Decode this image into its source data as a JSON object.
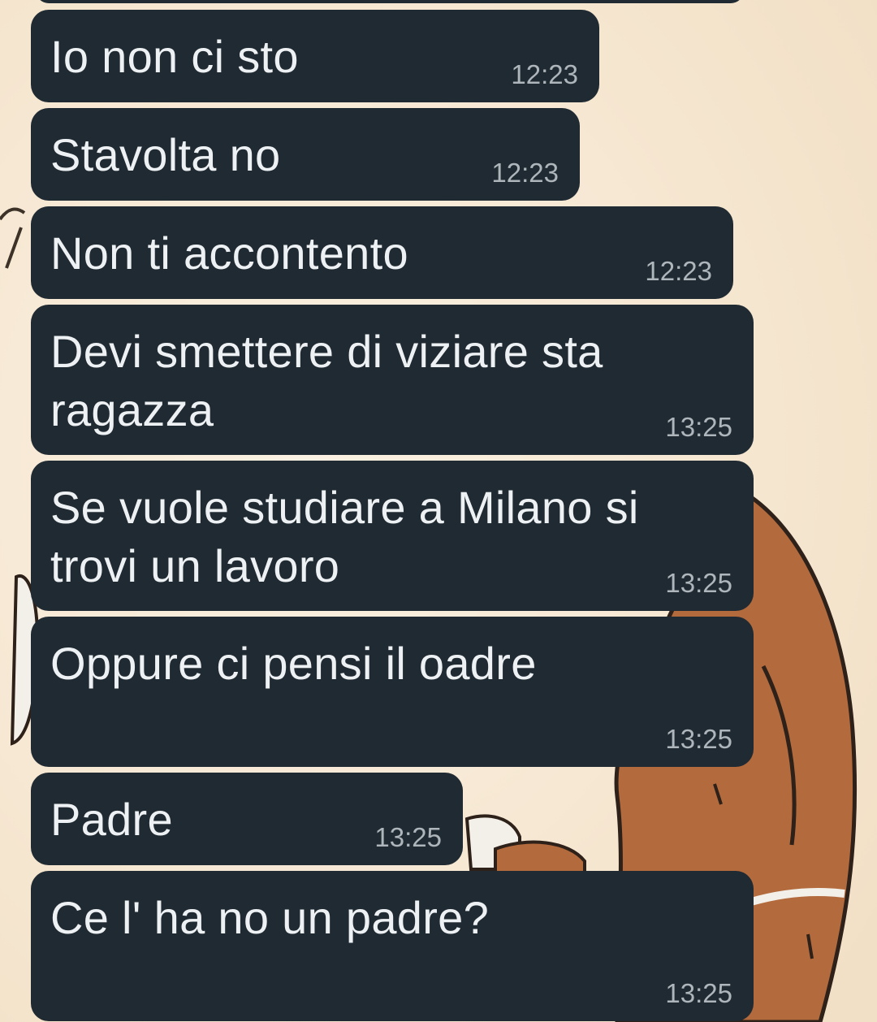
{
  "chat": {
    "messages": [
      {
        "text": "Io non ci sto",
        "time": "12:23"
      },
      {
        "text": "Stavolta no",
        "time": "12:23"
      },
      {
        "text": "Non ti accontento",
        "time": "12:23"
      },
      {
        "text": "Devi smettere di viziare sta ragazza",
        "time": "13:25"
      },
      {
        "text": "Se vuole studiare a Milano si trovi un lavoro",
        "time": "13:25"
      },
      {
        "text": "Oppure ci pensi il oadre",
        "time": "13:25"
      },
      {
        "text": "Padre",
        "time": "13:25"
      },
      {
        "text": "Ce l' ha no un padre?",
        "time": "13:25"
      }
    ]
  },
  "colors": {
    "bubble": "#202a32",
    "text": "#eef1f3",
    "timestamp": "#aeb6bc",
    "wallpaper": "#f6e8d3",
    "wallpaper_character": "#b36a3c"
  }
}
